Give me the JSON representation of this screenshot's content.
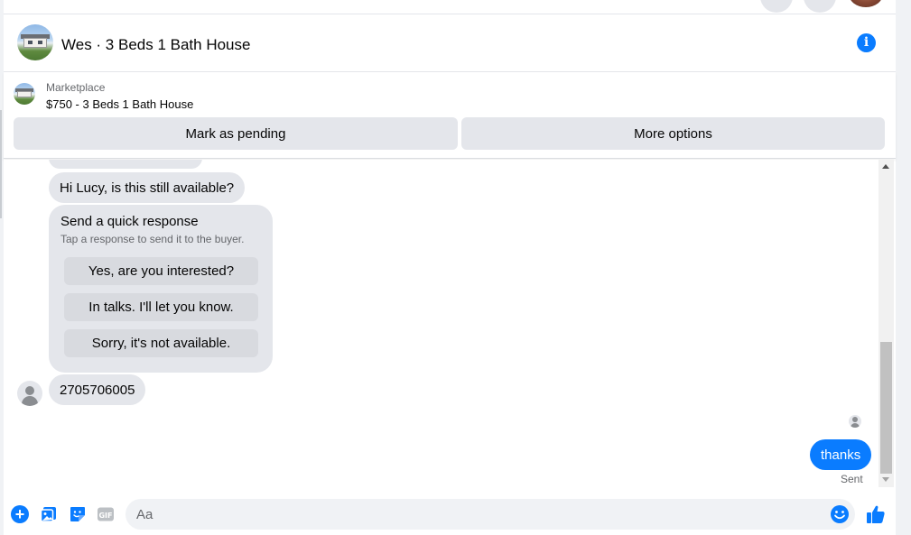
{
  "colors": {
    "accent": "#0a7cff",
    "bubble_incoming": "#e4e6eb",
    "text_primary": "#050505",
    "text_secondary": "#65676b"
  },
  "header": {
    "title": "Wes · 3 Beds 1 Bath House",
    "info_icon": "info-icon"
  },
  "listing": {
    "source_label": "Marketplace",
    "price_title": "$750 - 3 Beds 1 Bath House",
    "actions": {
      "mark_pending": "Mark as pending",
      "more_options": "More options"
    }
  },
  "messages": {
    "incoming_1": "Hi Lucy, is this still available?",
    "quick_response": {
      "title": "Send a quick response",
      "subtitle": "Tap a response to send it to the buyer.",
      "options": [
        "Yes, are you interested?",
        "In talks. I'll let you know.",
        "Sorry, it's not available."
      ]
    },
    "incoming_2": "2705706005",
    "outgoing_1": "thanks",
    "outgoing_status": "Sent"
  },
  "composer": {
    "placeholder": "Aa",
    "icons": [
      "plus-icon",
      "image-icon",
      "sticker-icon",
      "gif-icon",
      "emoji-icon",
      "like-icon"
    ]
  }
}
